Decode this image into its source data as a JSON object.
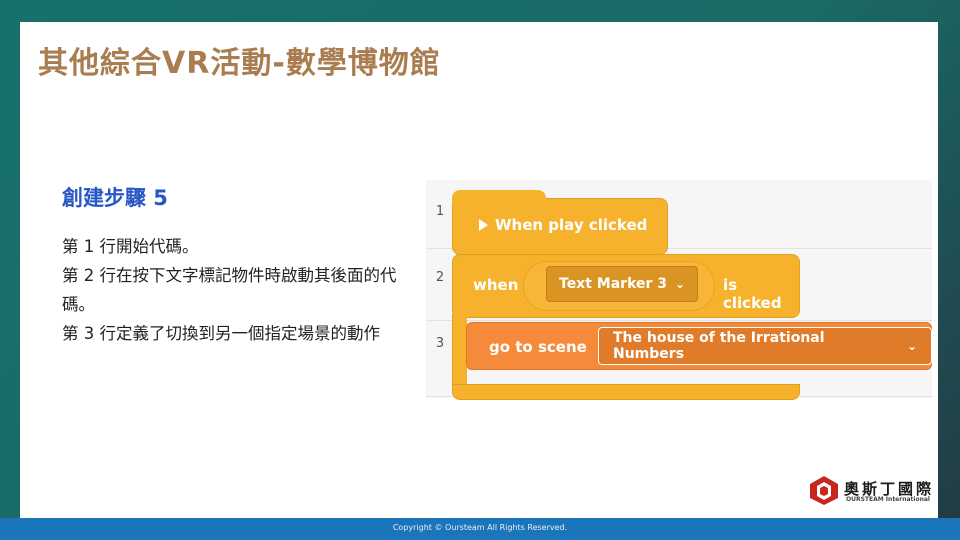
{
  "slide": {
    "title": "其他綜合VR活動-數學博物館",
    "step_heading": "創建步驟 5",
    "lines": [
      "第 1 行開始代碼。",
      "第 2 行在按下文字標記物件時啟動其後面的代碼。",
      "第 3 行定義了切換到另一個指定場景的動作"
    ]
  },
  "code": {
    "line_numbers": [
      "1",
      "2",
      "3"
    ],
    "block1": {
      "play_icon": "play-icon",
      "label": "When play clicked"
    },
    "block2": {
      "when": "when",
      "marker": "Text Marker 3",
      "is_clicked": "is clicked"
    },
    "block3": {
      "label": "go to scene",
      "scene": "The house of the Irrational Numbers"
    },
    "colors": {
      "event_yellow": "#f6b22d",
      "scene_orange": "#f58a3a",
      "dropdown_brown": "#d99424"
    }
  },
  "logo": {
    "name": "奧斯丁國際",
    "sub": "OURSTEAM International"
  },
  "footer": {
    "copyright": "Copyright © Oursteam All Rights Reserved."
  }
}
